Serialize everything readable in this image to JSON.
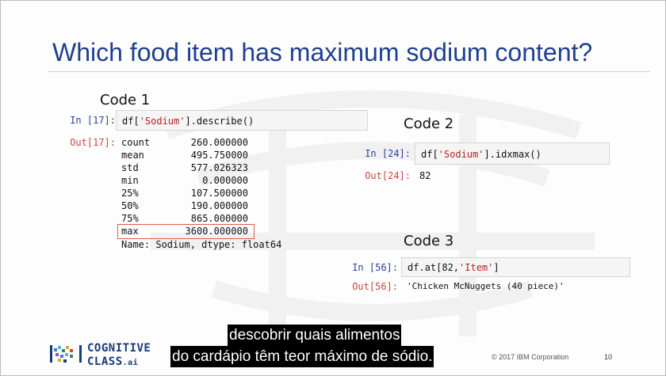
{
  "slide": {
    "title": "Which food item has maximum sodium content?",
    "slide_number": "10",
    "copyright": "© 2017 IBM Corporation"
  },
  "code1": {
    "label": "Code 1",
    "in_prompt": "In [17]:",
    "code_prefix": "df[",
    "code_string": "'Sodium'",
    "code_suffix": "].describe()",
    "out_prompt": "Out[17]:",
    "rows": [
      {
        "key": "count",
        "value": "260.000000"
      },
      {
        "key": "mean",
        "value": "495.750000"
      },
      {
        "key": "std",
        "value": "577.026323"
      },
      {
        "key": "min",
        "value": "0.000000"
      },
      {
        "key": "25%",
        "value": "107.500000"
      },
      {
        "key": "50%",
        "value": "190.000000"
      },
      {
        "key": "75%",
        "value": "865.000000"
      },
      {
        "key": "max",
        "value": "3600.000000"
      }
    ],
    "footer": "Name: Sodium, dtype: float64"
  },
  "code2": {
    "label": "Code 2",
    "in_prompt": "In [24]:",
    "code_prefix": "df[",
    "code_string": "'Sodium'",
    "code_suffix": "].idxmax()",
    "out_prompt": "Out[24]:",
    "output": "82"
  },
  "code3": {
    "label": "Code 3",
    "in_prompt": "In [56]:",
    "code_prefix": "df.at[82,",
    "code_string": "'Item'",
    "code_suffix": "]",
    "out_prompt": "Out[56]:",
    "output": "'Chicken McNuggets (40 piece)'"
  },
  "logo": {
    "line1": "COGNITIVE",
    "line2": "CLASS",
    "suffix": ".ai"
  },
  "subtitles": {
    "line1": "descobrir quais alimentos",
    "line2": "do cardápio têm teor máximo de sódio."
  },
  "colors": {
    "title": "#1f3f8f",
    "in_prompt": "#2b3f9f",
    "out_prompt": "#c9473a",
    "string_literal": "#b22222",
    "highlight_box": "#e05a4a"
  }
}
